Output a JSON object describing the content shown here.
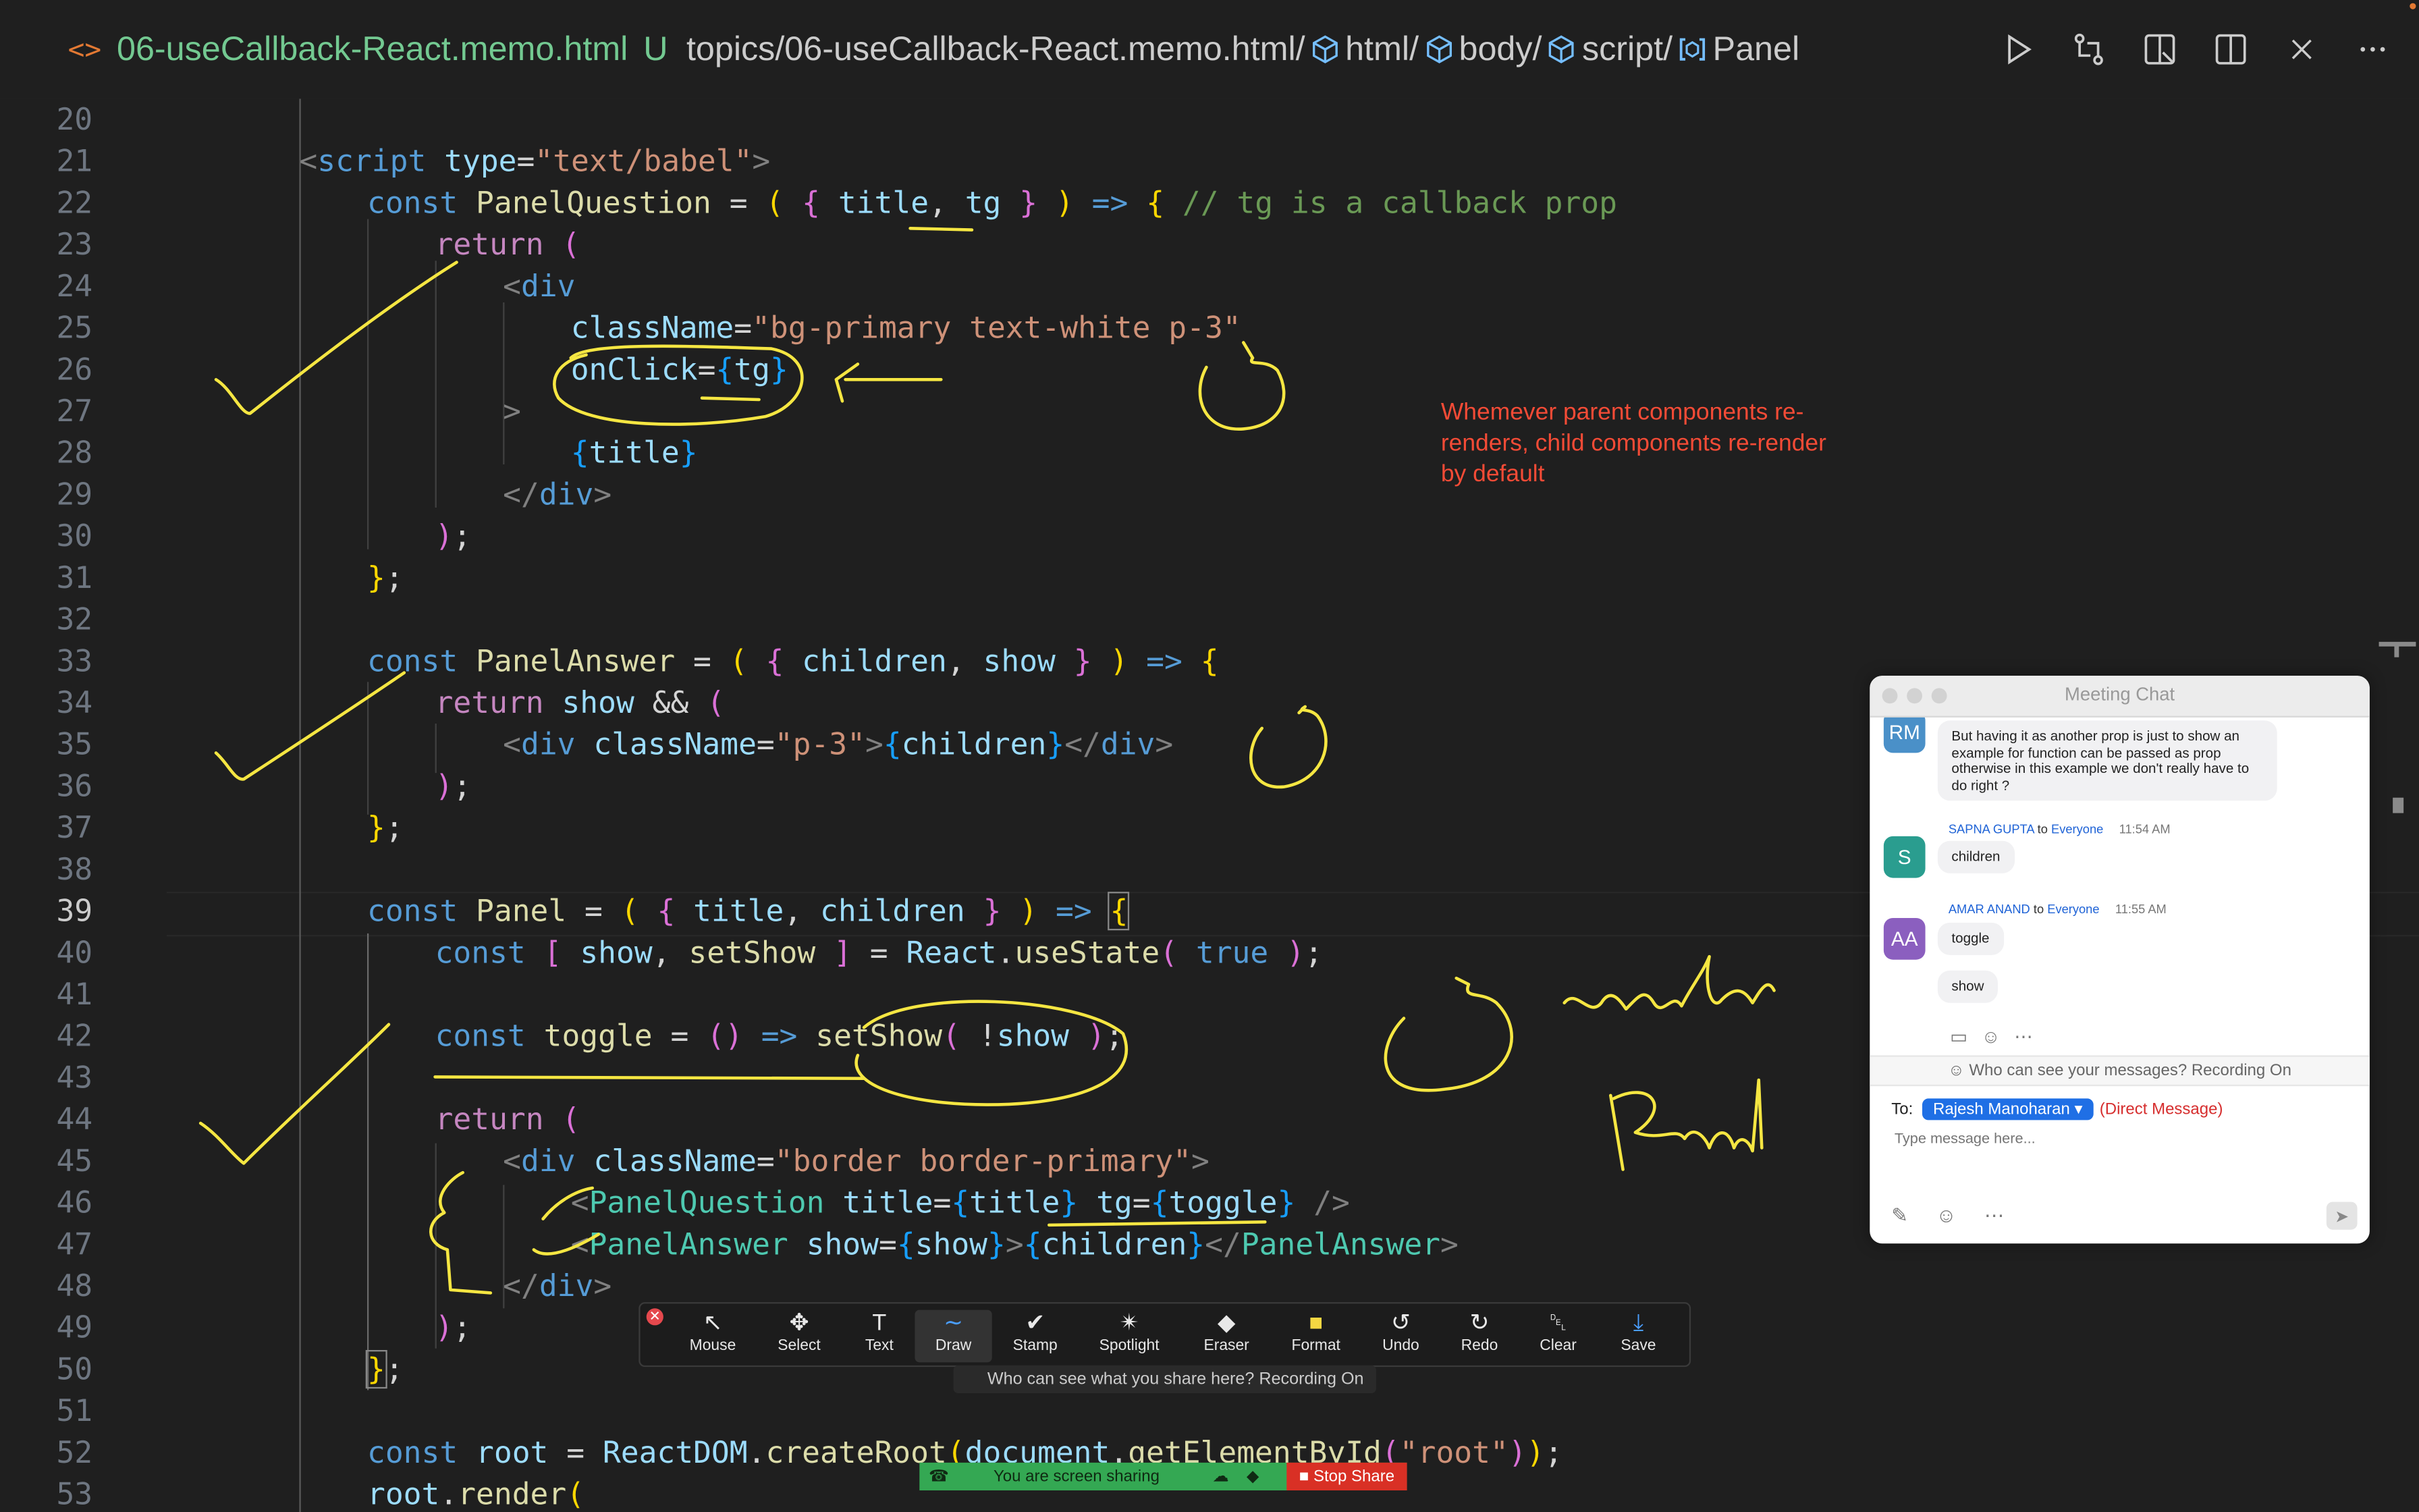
{
  "titlebar": {
    "file_icon": "<>",
    "file_name": "06-useCallback-React.memo.html",
    "git_status": "U",
    "path_root": "topics/06-useCallback-React.memo.html/",
    "crumbs": [
      "html/",
      "body/",
      "script/",
      "Panel"
    ],
    "crumb_icons": [
      "cube-icon",
      "cube-icon",
      "cube-icon",
      "variable-icon"
    ],
    "actions": [
      "run-icon",
      "compare-changes-icon",
      "open-preview-icon",
      "split-editor-icon",
      "close-icon",
      "more-icon"
    ]
  },
  "editor": {
    "active_line": 39,
    "lines": [
      {
        "n": 20,
        "tokens": []
      },
      {
        "n": 21,
        "tokens": [
          [
            "tg",
            "<"
          ],
          [
            "t",
            "script"
          ],
          [
            "p",
            " "
          ],
          [
            "a",
            "type"
          ],
          [
            "p",
            "="
          ],
          [
            "s",
            "\"text/babel\""
          ],
          [
            "tg",
            ">"
          ]
        ]
      },
      {
        "n": 22,
        "tokens": [
          [
            "k",
            "const"
          ],
          [
            "p",
            " "
          ],
          [
            "f",
            "PanelQuestion"
          ],
          [
            "p",
            " = "
          ],
          [
            "b1",
            "("
          ],
          [
            "p",
            " "
          ],
          [
            "b2",
            "{"
          ],
          [
            "p",
            " "
          ],
          [
            "v",
            "title"
          ],
          [
            "p",
            ", "
          ],
          [
            "v",
            "tg"
          ],
          [
            "p",
            " "
          ],
          [
            "b2",
            "}"
          ],
          [
            "p",
            " "
          ],
          [
            "b1",
            ")"
          ],
          [
            "p",
            " "
          ],
          [
            "k",
            "=>"
          ],
          [
            "p",
            " "
          ],
          [
            "b1",
            "{"
          ],
          [
            "p",
            " "
          ],
          [
            "cm",
            "// tg is a callback prop"
          ]
        ]
      },
      {
        "n": 23,
        "tokens": [
          [
            "c",
            "return"
          ],
          [
            "p",
            " "
          ],
          [
            "b2",
            "("
          ]
        ]
      },
      {
        "n": 24,
        "tokens": [
          [
            "tg",
            "<"
          ],
          [
            "t",
            "div"
          ]
        ]
      },
      {
        "n": 25,
        "tokens": [
          [
            "a",
            "className"
          ],
          [
            "p",
            "="
          ],
          [
            "s",
            "\"bg-primary text-white p-3\""
          ]
        ]
      },
      {
        "n": 26,
        "tokens": [
          [
            "a",
            "onClick"
          ],
          [
            "p",
            "="
          ],
          [
            "b3",
            "{"
          ],
          [
            "v",
            "tg"
          ],
          [
            "b3",
            "}"
          ]
        ]
      },
      {
        "n": 27,
        "tokens": [
          [
            "tg",
            ">"
          ]
        ]
      },
      {
        "n": 28,
        "tokens": [
          [
            "b3",
            "{"
          ],
          [
            "v",
            "title"
          ],
          [
            "b3",
            "}"
          ]
        ]
      },
      {
        "n": 29,
        "tokens": [
          [
            "tg",
            "</"
          ],
          [
            "t",
            "div"
          ],
          [
            "tg",
            ">"
          ]
        ]
      },
      {
        "n": 30,
        "tokens": [
          [
            "b2",
            ")"
          ],
          [
            "p",
            ";"
          ]
        ]
      },
      {
        "n": 31,
        "tokens": [
          [
            "b1",
            "}"
          ],
          [
            "p",
            ";"
          ]
        ]
      },
      {
        "n": 32,
        "tokens": []
      },
      {
        "n": 33,
        "tokens": [
          [
            "k",
            "const"
          ],
          [
            "p",
            " "
          ],
          [
            "f",
            "PanelAnswer"
          ],
          [
            "p",
            " = "
          ],
          [
            "b1",
            "("
          ],
          [
            "p",
            " "
          ],
          [
            "b2",
            "{"
          ],
          [
            "p",
            " "
          ],
          [
            "v",
            "children"
          ],
          [
            "p",
            ", "
          ],
          [
            "v",
            "show"
          ],
          [
            "p",
            " "
          ],
          [
            "b2",
            "}"
          ],
          [
            "p",
            " "
          ],
          [
            "b1",
            ")"
          ],
          [
            "p",
            " "
          ],
          [
            "k",
            "=>"
          ],
          [
            "p",
            " "
          ],
          [
            "b1",
            "{"
          ]
        ]
      },
      {
        "n": 34,
        "tokens": [
          [
            "c",
            "return"
          ],
          [
            "p",
            " "
          ],
          [
            "v",
            "show"
          ],
          [
            "p",
            " && "
          ],
          [
            "b2",
            "("
          ]
        ]
      },
      {
        "n": 35,
        "tokens": [
          [
            "tg",
            "<"
          ],
          [
            "t",
            "div"
          ],
          [
            "p",
            " "
          ],
          [
            "a",
            "className"
          ],
          [
            "p",
            "="
          ],
          [
            "s",
            "\"p-3\""
          ],
          [
            "tg",
            ">"
          ],
          [
            "b3",
            "{"
          ],
          [
            "v",
            "children"
          ],
          [
            "b3",
            "}"
          ],
          [
            "tg",
            "</"
          ],
          [
            "t",
            "div"
          ],
          [
            "tg",
            ">"
          ]
        ]
      },
      {
        "n": 36,
        "tokens": [
          [
            "b2",
            ")"
          ],
          [
            "p",
            ";"
          ]
        ]
      },
      {
        "n": 37,
        "tokens": [
          [
            "b1",
            "}"
          ],
          [
            "p",
            ";"
          ]
        ]
      },
      {
        "n": 38,
        "tokens": []
      },
      {
        "n": 39,
        "tokens": [
          [
            "k",
            "const"
          ],
          [
            "p",
            " "
          ],
          [
            "f",
            "Panel"
          ],
          [
            "p",
            " = "
          ],
          [
            "b1",
            "("
          ],
          [
            "p",
            " "
          ],
          [
            "b2",
            "{"
          ],
          [
            "p",
            " "
          ],
          [
            "v",
            "title"
          ],
          [
            "p",
            ", "
          ],
          [
            "v",
            "children"
          ],
          [
            "p",
            " "
          ],
          [
            "b2",
            "}"
          ],
          [
            "p",
            " "
          ],
          [
            "b1",
            ")"
          ],
          [
            "p",
            " "
          ],
          [
            "k",
            "=>"
          ],
          [
            "p",
            " "
          ],
          [
            "b1",
            "{"
          ]
        ]
      },
      {
        "n": 40,
        "tokens": [
          [
            "k",
            "const"
          ],
          [
            "p",
            " "
          ],
          [
            "b2",
            "["
          ],
          [
            "p",
            " "
          ],
          [
            "v",
            "show"
          ],
          [
            "p",
            ", "
          ],
          [
            "f",
            "setShow"
          ],
          [
            "p",
            " "
          ],
          [
            "b2",
            "]"
          ],
          [
            "p",
            " = "
          ],
          [
            "v",
            "React"
          ],
          [
            "p",
            "."
          ],
          [
            "f",
            "useState"
          ],
          [
            "b2",
            "("
          ],
          [
            "p",
            " "
          ],
          [
            "k",
            "true"
          ],
          [
            "p",
            " "
          ],
          [
            "b2",
            ")"
          ],
          [
            "p",
            ";"
          ]
        ]
      },
      {
        "n": 41,
        "tokens": []
      },
      {
        "n": 42,
        "tokens": [
          [
            "k",
            "const"
          ],
          [
            "p",
            " "
          ],
          [
            "f",
            "toggle"
          ],
          [
            "p",
            " = "
          ],
          [
            "b2",
            "()"
          ],
          [
            "p",
            " "
          ],
          [
            "k",
            "=>"
          ],
          [
            "p",
            " "
          ],
          [
            "f",
            "setShow"
          ],
          [
            "b2",
            "("
          ],
          [
            "p",
            " !"
          ],
          [
            "v",
            "show"
          ],
          [
            "p",
            " "
          ],
          [
            "b2",
            ")"
          ],
          [
            "p",
            ";"
          ]
        ]
      },
      {
        "n": 43,
        "tokens": []
      },
      {
        "n": 44,
        "tokens": [
          [
            "c",
            "return"
          ],
          [
            "p",
            " "
          ],
          [
            "b2",
            "("
          ]
        ]
      },
      {
        "n": 45,
        "tokens": [
          [
            "tg",
            "<"
          ],
          [
            "t",
            "div"
          ],
          [
            "p",
            " "
          ],
          [
            "a",
            "className"
          ],
          [
            "p",
            "="
          ],
          [
            "s",
            "\"border border-primary\""
          ],
          [
            "tg",
            ">"
          ]
        ]
      },
      {
        "n": 46,
        "tokens": [
          [
            "tg",
            "<"
          ],
          [
            "comp",
            "PanelQuestion"
          ],
          [
            "p",
            " "
          ],
          [
            "a",
            "title"
          ],
          [
            "p",
            "="
          ],
          [
            "b3",
            "{"
          ],
          [
            "v",
            "title"
          ],
          [
            "b3",
            "}"
          ],
          [
            "p",
            " "
          ],
          [
            "a",
            "tg"
          ],
          [
            "p",
            "="
          ],
          [
            "b3",
            "{"
          ],
          [
            "v",
            "toggle"
          ],
          [
            "b3",
            "}"
          ],
          [
            "p",
            " "
          ],
          [
            "tg",
            "/>"
          ]
        ]
      },
      {
        "n": 47,
        "tokens": [
          [
            "tg",
            "<"
          ],
          [
            "comp",
            "PanelAnswer"
          ],
          [
            "p",
            " "
          ],
          [
            "a",
            "show"
          ],
          [
            "p",
            "="
          ],
          [
            "b3",
            "{"
          ],
          [
            "v",
            "show"
          ],
          [
            "b3",
            "}"
          ],
          [
            "tg",
            ">"
          ],
          [
            "b3",
            "{"
          ],
          [
            "v",
            "children"
          ],
          [
            "b3",
            "}"
          ],
          [
            "tg",
            "</"
          ],
          [
            "comp",
            "PanelAnswer"
          ],
          [
            "tg",
            ">"
          ]
        ]
      },
      {
        "n": 48,
        "tokens": [
          [
            "tg",
            "</"
          ],
          [
            "t",
            "div"
          ],
          [
            "tg",
            ">"
          ]
        ]
      },
      {
        "n": 49,
        "tokens": [
          [
            "b2",
            ")"
          ],
          [
            "p",
            ";"
          ]
        ]
      },
      {
        "n": 50,
        "tokens": [
          [
            "b1",
            "}"
          ],
          [
            "p",
            ";"
          ]
        ]
      },
      {
        "n": 51,
        "tokens": []
      },
      {
        "n": 52,
        "tokens": [
          [
            "k",
            "const"
          ],
          [
            "p",
            " "
          ],
          [
            "v",
            "root"
          ],
          [
            "p",
            " = "
          ],
          [
            "v",
            "ReactDOM"
          ],
          [
            "p",
            "."
          ],
          [
            "f",
            "createRoot"
          ],
          [
            "b1",
            "("
          ],
          [
            "v",
            "document"
          ],
          [
            "p",
            "."
          ],
          [
            "f",
            "getElementById"
          ],
          [
            "b2",
            "("
          ],
          [
            "s",
            "\"root\""
          ],
          [
            "b2",
            ")"
          ],
          [
            "b1",
            ")"
          ],
          [
            "p",
            ";"
          ]
        ]
      },
      {
        "n": 53,
        "tokens": [
          [
            "v",
            "root"
          ],
          [
            "p",
            "."
          ],
          [
            "f",
            "render"
          ],
          [
            "b1",
            "("
          ]
        ]
      }
    ]
  },
  "annotation": {
    "note": "Whemever parent components re-renders, child components re-render by default",
    "handwriting": [
      "render",
      "Panel"
    ]
  },
  "meeting_chat": {
    "title": "Meeting Chat",
    "messages": [
      {
        "initials": "RM",
        "color": "#4a90c8",
        "sender": "",
        "to": "",
        "time": "",
        "text": "But having it as another prop is just to show an example for function can be passed as prop otherwise in this example we don't really have to do right ?"
      },
      {
        "initials": "S",
        "color": "#2a9d8f",
        "sender": "SAPNA GUPTA",
        "to": "to",
        "recipient": "Everyone",
        "time": "11:54 AM",
        "text": "children"
      },
      {
        "initials": "AA",
        "color": "#8b5fbf",
        "sender": "AMAR ANAND",
        "to": "to",
        "recipient": "Everyone",
        "time": "11:55 AM",
        "text": "toggle",
        "text2": "show"
      }
    ],
    "privacy_notice": "Who can see your messages? Recording On",
    "to_label": "To:",
    "recipient": "Rajesh Manoharan",
    "direct_label": "(Direct Message)",
    "input_placeholder": "Type message here..."
  },
  "annotate_toolbar": {
    "tools": [
      "Mouse",
      "Select",
      "Text",
      "Draw",
      "Stamp",
      "Spotlight",
      "Eraser",
      "Format",
      "Undo",
      "Redo",
      "Clear",
      "Save"
    ],
    "active_tool": "Draw",
    "share_notice": "Who can see what you share here? Recording On"
  },
  "share_bar": {
    "status": "You are screen sharing",
    "stop_label": "Stop Share"
  },
  "colors": {
    "editor_bg": "#1f1f1f",
    "annotation_ink": "#f5e642",
    "note_red": "#f44b36",
    "share_green": "#34a853",
    "stop_red": "#d93025"
  }
}
